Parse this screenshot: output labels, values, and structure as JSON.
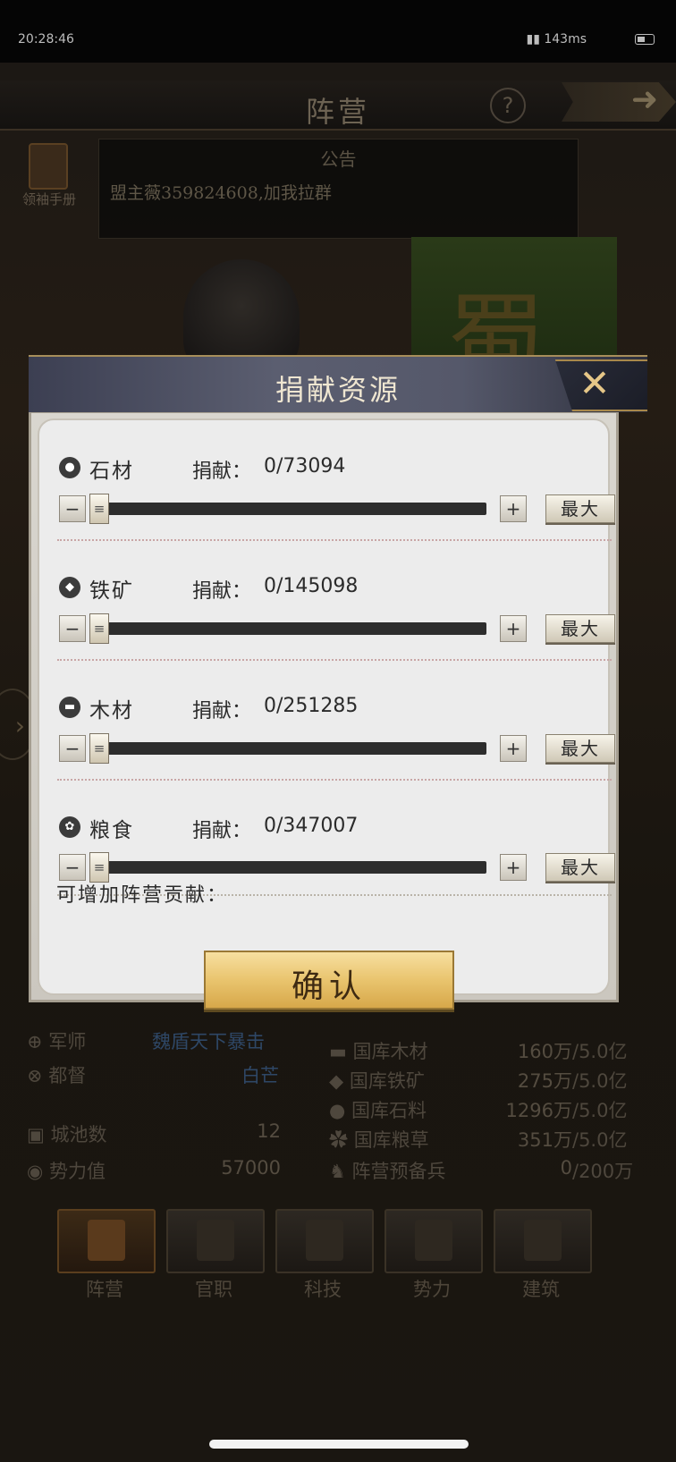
{
  "status_bar": {
    "time": "20:28:46",
    "network": "143ms"
  },
  "header": {
    "title": "阵营",
    "help": "?"
  },
  "manual": {
    "label": "领袖手册"
  },
  "notice": {
    "title": "公告",
    "text": "盟主薇359824608,加我拉群"
  },
  "banner": {
    "char": "蜀"
  },
  "officials": [
    {
      "role": "军师",
      "name": "魏盾天下暴击"
    },
    {
      "role": "都督",
      "name": "白芒"
    }
  ],
  "city_stats": [
    {
      "label": "城池数",
      "value": "12"
    },
    {
      "label": "势力值",
      "value": "57000"
    }
  ],
  "treasury": [
    {
      "label": "国库木材",
      "current": "160万",
      "max": "/5.0亿"
    },
    {
      "label": "国库铁矿",
      "current": "275万",
      "max": "/5.0亿"
    },
    {
      "label": "国库石料",
      "current": "1296万",
      "max": "/5.0亿"
    },
    {
      "label": "国库粮草",
      "current": "351万",
      "max": "/5.0亿"
    },
    {
      "label": "阵营预备兵",
      "current": "0",
      "max": "/200万"
    }
  ],
  "bottom_nav": [
    {
      "label": "阵营",
      "icon": "banner-icon"
    },
    {
      "label": "官职",
      "icon": "seal-icon"
    },
    {
      "label": "科技",
      "icon": "scroll-icon"
    },
    {
      "label": "势力",
      "icon": "weapons-icon"
    },
    {
      "label": "建筑",
      "icon": "building-icon"
    }
  ],
  "modal": {
    "title": "捐献资源",
    "donate_label": "捐献：",
    "minus": "−",
    "plus": "+",
    "max_label": "最大",
    "resources": [
      {
        "name": "石材",
        "icon": "stone-icon",
        "value": "0/73094",
        "donated": 0,
        "max": 73094
      },
      {
        "name": "铁矿",
        "icon": "iron-ore-icon",
        "value": "0/145098",
        "donated": 0,
        "max": 145098
      },
      {
        "name": "木材",
        "icon": "wood-icon",
        "value": "0/251285",
        "donated": 0,
        "max": 251285
      },
      {
        "name": "粮食",
        "icon": "grain-icon",
        "value": "0/347007",
        "donated": 0,
        "max": 347007
      }
    ],
    "contribution_label": "可增加阵营贡献：",
    "confirm_label": "确认"
  },
  "colors": {
    "accent_gold": "#e9c46e",
    "modal_bg": "#ececec",
    "track": "#2d2d2d"
  }
}
